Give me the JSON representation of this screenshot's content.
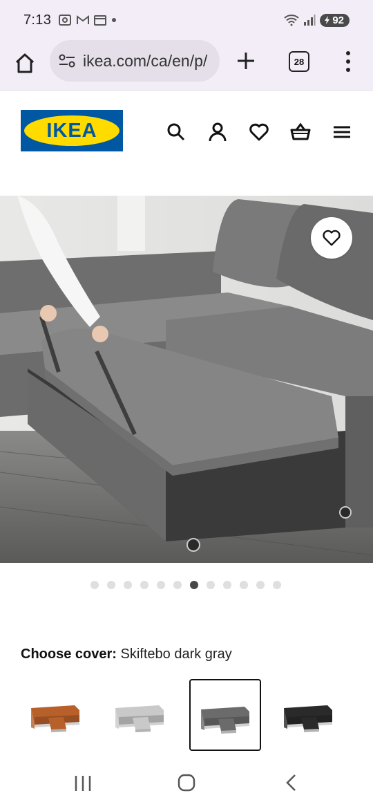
{
  "status_bar": {
    "time": "7:13",
    "battery": "92",
    "left_icons": [
      "screenshot-icon",
      "gmail-icon",
      "calendar-icon",
      "dot-icon"
    ],
    "right_icons": [
      "wifi-icon",
      "signal-icon",
      "battery-icon"
    ]
  },
  "browser": {
    "url": "ikea.com/ca/en/p/",
    "tab_count": "28"
  },
  "header": {
    "logo_text": "IKEA",
    "icons": [
      "search-icon",
      "account-icon",
      "favorites-icon",
      "cart-icon",
      "hamburger-menu-icon"
    ]
  },
  "gallery": {
    "image_alt": "Gray corner sleeper sofa with storage being opened",
    "dot_count": 12,
    "active_index": 6
  },
  "cover": {
    "label": "Choose cover:",
    "value": "Skiftebo dark gray",
    "options": [
      {
        "name": "orange",
        "color": "#b8602a"
      },
      {
        "name": "light-gray",
        "color": "#c9c9c9"
      },
      {
        "name": "dark-gray",
        "color": "#6b6b6b"
      },
      {
        "name": "black",
        "color": "#2a2a2a"
      }
    ],
    "selected_index": 2
  },
  "colors": {
    "ikea_blue": "#0058a3",
    "ikea_yellow": "#ffdb00",
    "chrome_bg": "#f3edf7"
  }
}
